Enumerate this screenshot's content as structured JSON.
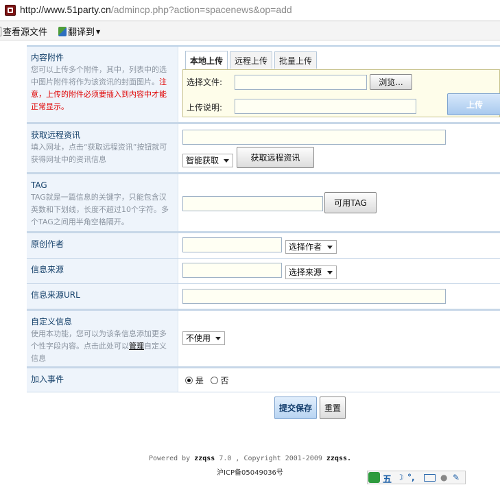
{
  "browser": {
    "url_host": "http://www.51party.cn",
    "url_path": "/admincp.php?action=spacenews&op=add"
  },
  "toolbar": {
    "view_source": "查看源文件",
    "translate": "翻译到"
  },
  "attach": {
    "title": "内容附件",
    "help_normal": "您可以上传多个附件，其中，列表中的选中图片附件将作为该资讯的封面图片。",
    "help_warning": "注意，上传的附件必须要插入到内容中才能正常显示。",
    "tabs": [
      "本地上传",
      "远程上传",
      "批量上传"
    ],
    "file_label": "选择文件:",
    "browse_button": "浏览...",
    "desc_label": "上传说明:",
    "upload_button": "上传"
  },
  "remote": {
    "title": "获取远程资讯",
    "help": "填入网址，点击“获取远程资讯”按钮就可获得网址中的资讯信息",
    "mode_select": "智能获取",
    "fetch_button": "获取远程资讯"
  },
  "tag": {
    "title": "TAG",
    "help": "TAG就是一篇信息的关键字，只能包含汉英数和下划线，长度不超过10个字符。多个TAG之间用半角空格隔开。",
    "button": "可用TAG"
  },
  "author": {
    "title": "原创作者",
    "select": "选择作者"
  },
  "source": {
    "title": "信息来源",
    "select": "选择来源"
  },
  "source_url": {
    "title": "信息来源URL"
  },
  "custom": {
    "title": "自定义信息",
    "help_before": "使用本功能，您可以为该条信息添加更多个性字段内容。点击此处可以",
    "help_link": "管理",
    "help_after": "自定义信息",
    "select": "不使用"
  },
  "event": {
    "title": "加入事件",
    "yes": "是",
    "no": "否",
    "selected": "yes"
  },
  "actions": {
    "submit": "提交保存",
    "reset": "重置"
  },
  "footer": {
    "powered_prefix": "Powered by ",
    "brand": "zzqss",
    "powered_mid": " 7.0 , Copyright 2001-2009 ",
    "brand2": "zzqss.",
    "icp": "沪ICP备05049036号"
  },
  "ime": {
    "mode": "五"
  }
}
